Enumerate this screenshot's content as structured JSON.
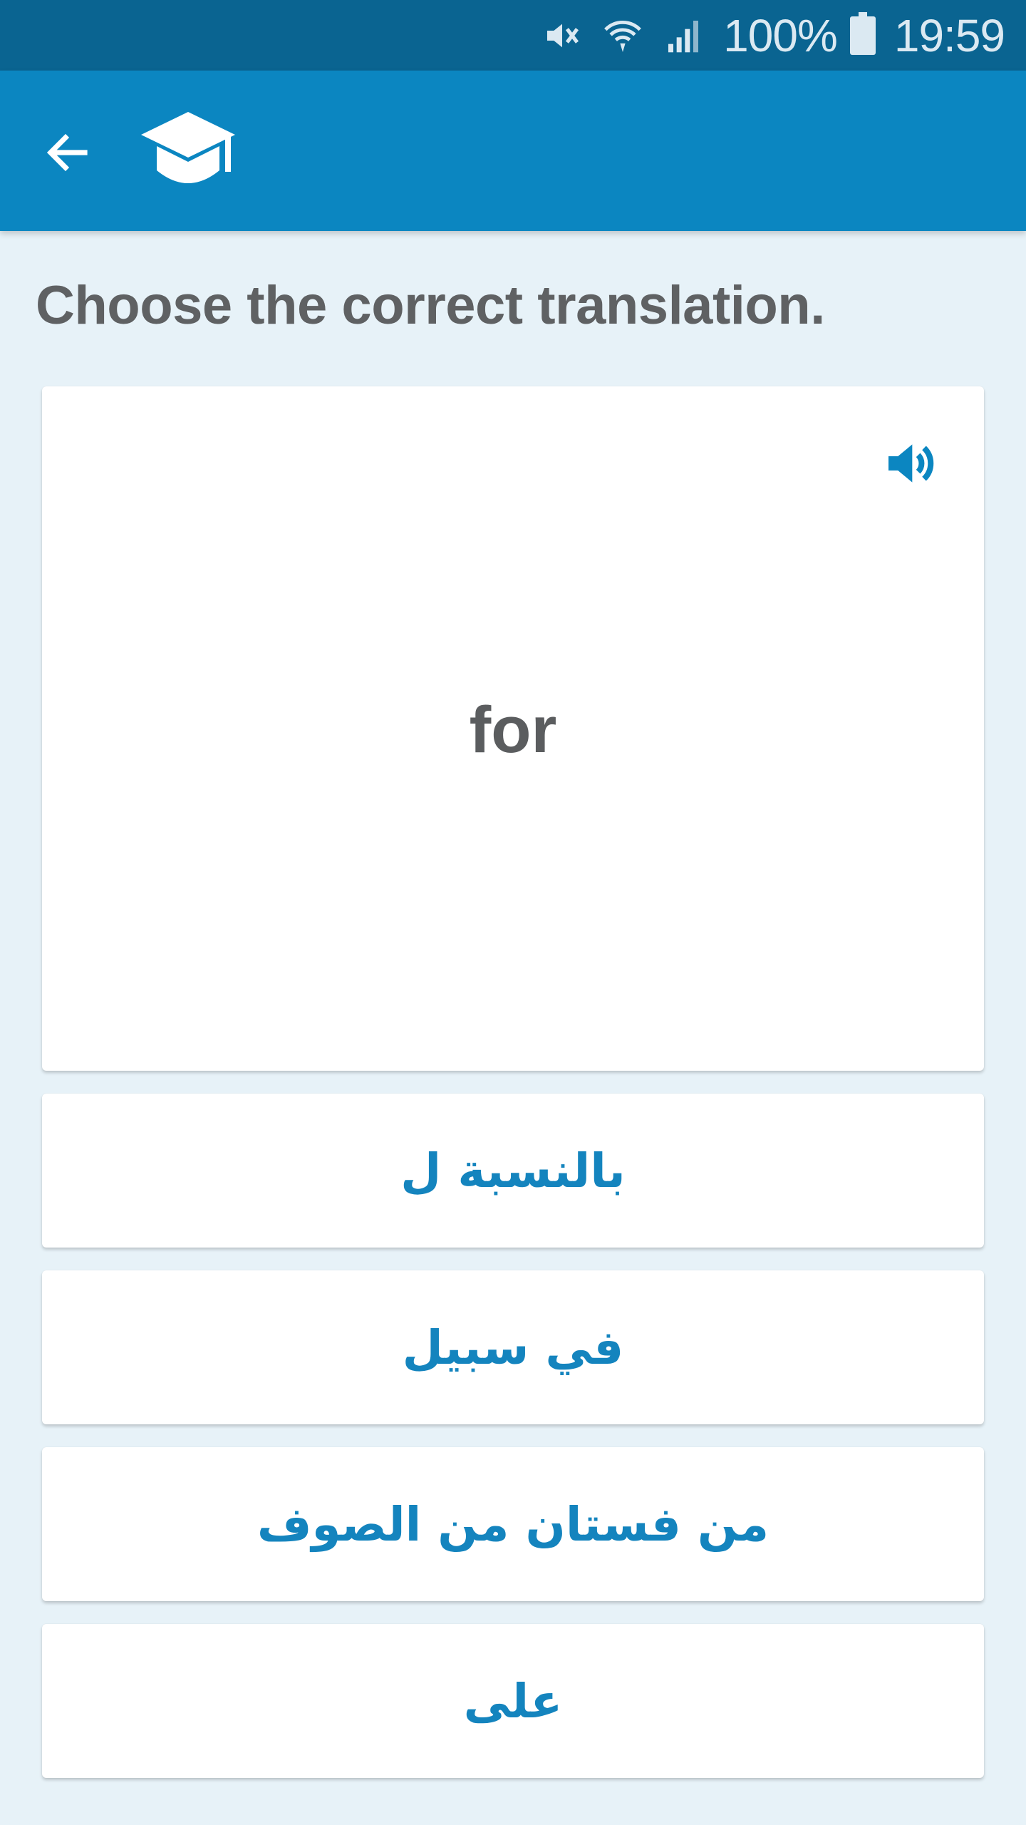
{
  "status_bar": {
    "icons": [
      "mute-icon",
      "wifi-icon",
      "signal-icon",
      "battery-icon"
    ],
    "battery": "100%",
    "time": "19:59"
  },
  "app_bar": {
    "back_icon": "arrow-left-icon",
    "logo_icon": "graduation-cap-icon",
    "color": "#0b86c1"
  },
  "quiz": {
    "instruction": "Choose the correct translation.",
    "word": "for",
    "speaker_icon": "speaker-icon",
    "answers": [
      "بالنسبة ل",
      "في سبيل",
      "من فستان من الصوف",
      "على"
    ]
  },
  "colors": {
    "status_bar": "#0a6491",
    "app_bar": "#0b86c1",
    "background": "#e7f2f8",
    "answer_text": "#1484be",
    "heading_text": "#5f6163"
  }
}
